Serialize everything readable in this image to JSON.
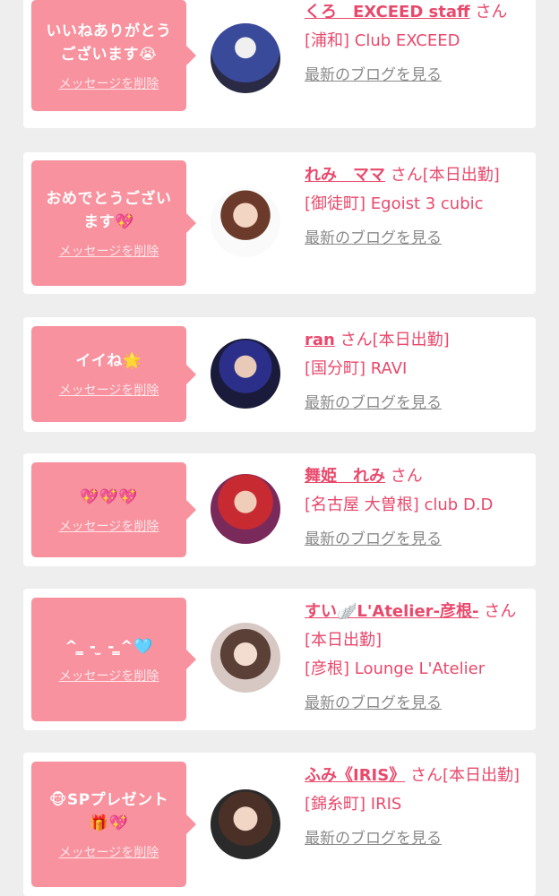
{
  "colors": {
    "accent": "#e8496c",
    "bubble": "#f7929e",
    "background": "#eeeeee"
  },
  "delete_label": "メッセージを削除",
  "blog_label": "最新のブログを見る",
  "items": [
    {
      "message_line1": "いいねありがとう",
      "message_line2": "ございます😭",
      "name": "くろ　EXCEED staff",
      "honorific": "さん",
      "status": "",
      "shop": "[浦和] Club EXCEED"
    },
    {
      "message_line1": "おめでとうござい",
      "message_line2": "ます💖",
      "name": "れみ　ママ",
      "honorific": "さん",
      "status": "[本日出勤]",
      "shop": "[御徒町] Egoist 3 cubic"
    },
    {
      "message_line1": "イイね🌟",
      "message_line2": "",
      "name": "ran",
      "honorific": "さん",
      "status": "[本日出勤]",
      "shop": "[国分町] RAVI"
    },
    {
      "message_line1": "💖💖💖",
      "message_line2": "",
      "name": "舞姫　れみ",
      "honorific": "さん",
      "status": "",
      "shop": "[名古屋 大曽根] club D.D"
    },
    {
      "message_line1": "^ ̳ - ̫ - ̳^🩵",
      "message_line2": "",
      "name": "すい🪽L'Atelier-彦根-",
      "honorific": "さん",
      "status": "[本日出勤]",
      "shop": "[彦根] Lounge L'Atelier"
    },
    {
      "message_line1": "🐵SPプレゼント",
      "message_line2": "🎁💖",
      "name": "ふみ《IRIS》",
      "honorific": "さん",
      "status": "[本日出勤]",
      "shop": "[錦糸町] IRIS"
    }
  ]
}
